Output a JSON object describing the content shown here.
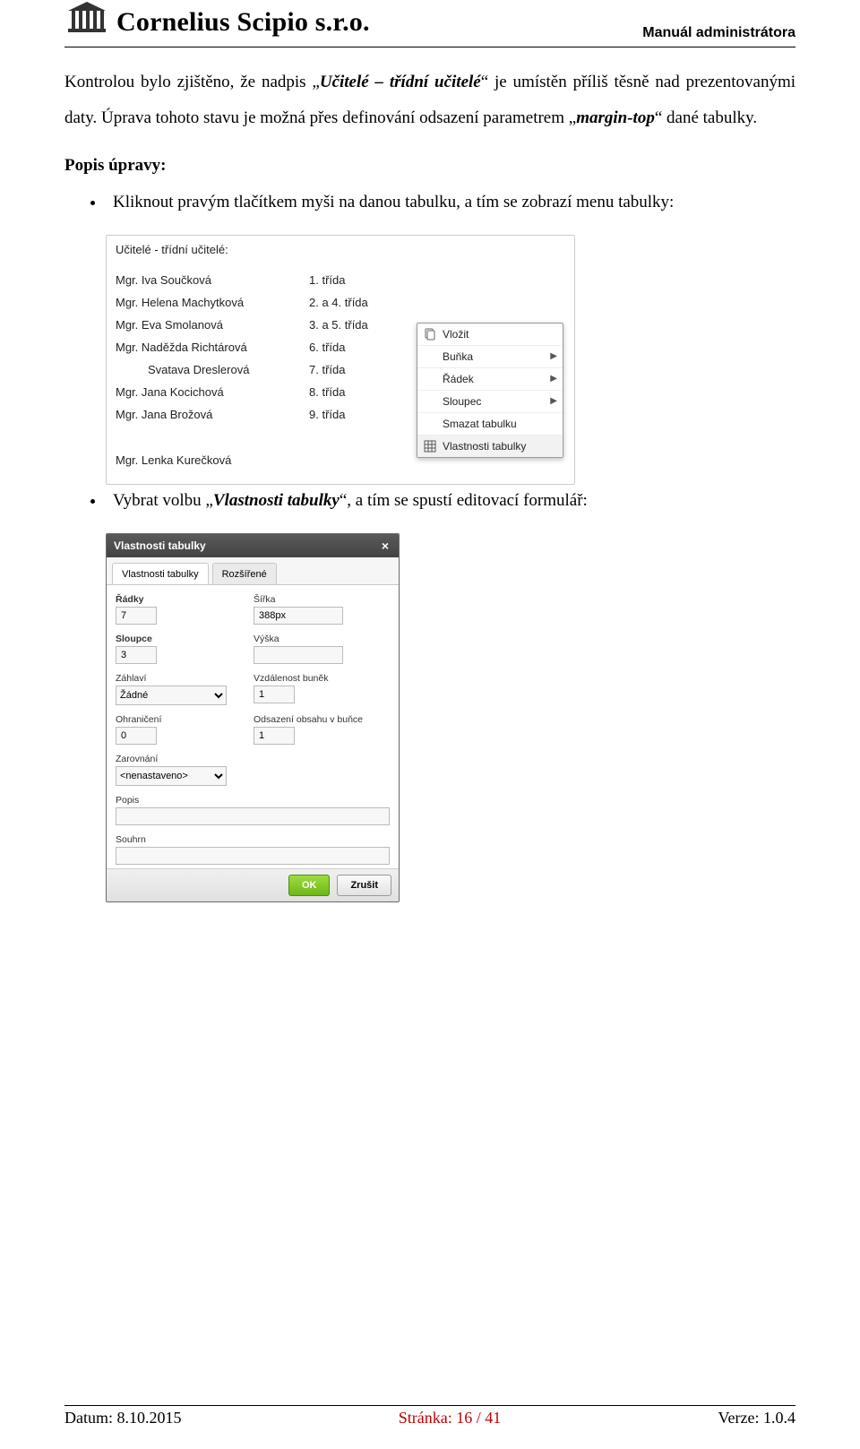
{
  "header": {
    "company": "Cornelius Scipio s.r.o.",
    "manual": "Manuál administrátora"
  },
  "para1": {
    "t1": "Kontrolou bylo zjištěno, že nadpis „",
    "em1": "Učitelé – třídní učitelé",
    "t2": "“ je umístěn příliš těsně nad prezentovanými daty. Úprava tohoto stavu je možná přes definování odsazení parametrem „",
    "em2": "margin-top",
    "t3": "“ dané tabulky."
  },
  "edit_heading": "Popis úpravy:",
  "bullets": {
    "b1": "Kliknout pravým tlačítkem myši na danou tabulku, a tím se zobrazí menu tabulky:",
    "b2_a": "Vybrat volbu „",
    "b2_em": "Vlastnosti tabulky",
    "b2_b": "“, a tím se spustí editovací formulář:"
  },
  "table_panel": {
    "heading": "Učitelé - třídní učitelé:",
    "rows": [
      {
        "name": "Mgr. Iva Součková",
        "class": "1. třída"
      },
      {
        "name": "Mgr. Helena Machytková",
        "class": "2. a 4. třída"
      },
      {
        "name": "Mgr. Eva Smolanová",
        "class": "3. a 5. třída"
      },
      {
        "name": "Mgr. Naděžda Richtárová",
        "class": "6. třída"
      },
      {
        "name": "Svatava Dreslerová",
        "class": "7. třída"
      },
      {
        "name": "Mgr. Jana Kocichová",
        "class": "8. třída"
      },
      {
        "name": "Mgr. Jana Brožová",
        "class": "9. třída"
      }
    ],
    "last": "Mgr. Lenka Kurečková"
  },
  "context_menu": {
    "items": [
      {
        "label": "Vložit",
        "icon": "paste-icon",
        "arrow": false
      },
      {
        "label": "Buňka",
        "icon": "",
        "arrow": true
      },
      {
        "label": "Řádek",
        "icon": "",
        "arrow": true
      },
      {
        "label": "Sloupec",
        "icon": "",
        "arrow": true
      },
      {
        "label": "Smazat tabulku",
        "icon": "",
        "arrow": false
      },
      {
        "label": "Vlastnosti tabulky",
        "icon": "grid-icon",
        "arrow": false
      }
    ]
  },
  "dialog": {
    "title": "Vlastnosti tabulky",
    "tabs": {
      "t1": "Vlastnosti tabulky",
      "t2": "Rozšířené"
    },
    "fields": {
      "rows_label": "Řádky",
      "rows_value": "7",
      "cols_label": "Sloupce",
      "cols_value": "3",
      "width_label": "Šířka",
      "width_value": "388px",
      "height_label": "Výška",
      "height_value": "",
      "header_label": "Záhlaví",
      "header_value": "Žádné",
      "border_label": "Ohraničení",
      "border_value": "0",
      "align_label": "Zarovnání",
      "align_value": "<nenastaveno>",
      "cellspacing_label": "Vzdálenost buněk",
      "cellspacing_value": "1",
      "cellpadding_label": "Odsazení obsahu v buňce",
      "cellpadding_value": "1",
      "caption_label": "Popis",
      "caption_value": "",
      "summary_label": "Souhrn",
      "summary_value": ""
    },
    "ok": "OK",
    "cancel": "Zrušit"
  },
  "footer": {
    "date_label": "Datum: ",
    "date_value": "8.10.2015",
    "page_label": "Stránka: ",
    "page_value": "16 / 41",
    "ver_label": "Verze: ",
    "ver_value": "1.0.4"
  }
}
